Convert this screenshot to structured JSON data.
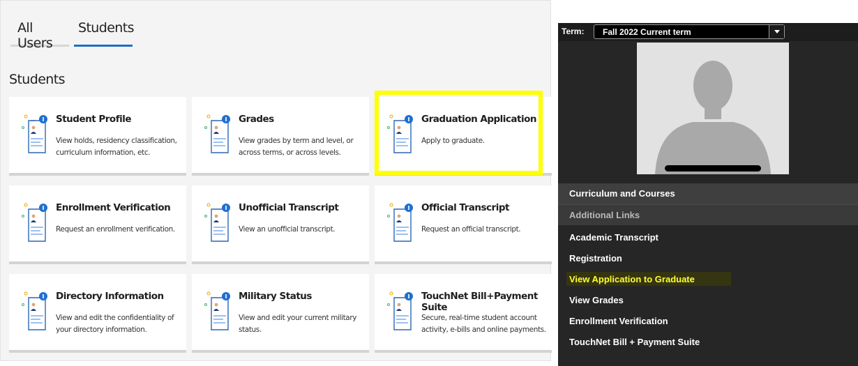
{
  "tabs": [
    {
      "label": "All Users",
      "active": false
    },
    {
      "label": "Students",
      "active": true
    }
  ],
  "section_title": "Students",
  "cards": [
    {
      "title": "Student Profile",
      "desc": "View holds, residency classification, curriculum information, etc."
    },
    {
      "title": "Grades",
      "desc": "View grades by term and level, or across terms, or across levels."
    },
    {
      "title": "Graduation Application",
      "desc": "Apply to graduate.",
      "highlighted": true
    },
    {
      "title": "Enrollment Verification",
      "desc": "Request an enrollment verification."
    },
    {
      "title": "Unofficial Transcript",
      "desc": "View an unofficial transcript."
    },
    {
      "title": "Official Transcript",
      "desc": "Request an official transcript."
    },
    {
      "title": "Directory Information",
      "desc": "View and edit the confidentiality of your directory information."
    },
    {
      "title": "Military Status",
      "desc": "View and edit your current military status."
    },
    {
      "title": "TouchNet Bill+Payment Suite",
      "desc": "Secure, real-time student account activity, e-bills and online payments."
    }
  ],
  "right_panel": {
    "term_label": "Term:",
    "term_value": "Fall 2022 Current term",
    "nav": {
      "curriculum": "Curriculum and Courses",
      "additional": "Additional Links"
    },
    "links": [
      {
        "label": "Academic Transcript"
      },
      {
        "label": "Registration"
      },
      {
        "label": "View Application to Graduate",
        "highlighted": true
      },
      {
        "label": "View Grades"
      },
      {
        "label": "Enrollment Verification"
      },
      {
        "label": "TouchNet Bill + Payment Suite"
      }
    ]
  },
  "colors": {
    "accent_blue": "#1c6fc4",
    "highlight_yellow": "#ffff00",
    "dark_panel": "#262626"
  },
  "icons": {
    "card_icon": "document-person-info-icon",
    "dropdown": "chevron-down-icon",
    "avatar": "avatar-placeholder"
  }
}
